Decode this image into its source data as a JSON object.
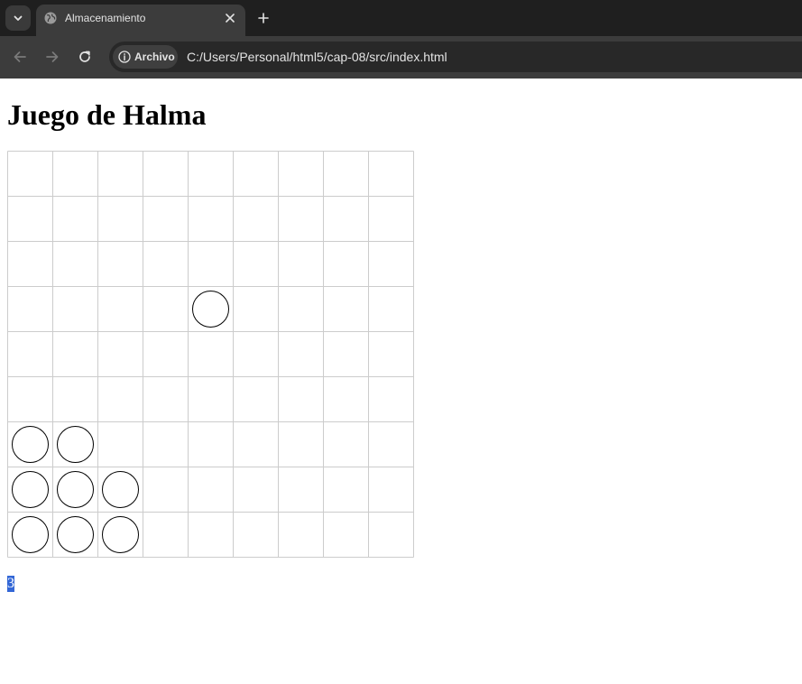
{
  "browser": {
    "tab_title": "Almacenamiento",
    "security_label": "Archivo",
    "url": "C:/Users/Personal/html5/cap-08/src/index.html"
  },
  "page": {
    "title": "Juego de Halma",
    "move_count": "3"
  },
  "board": {
    "columns": 9,
    "rows": 9,
    "grid_color": "#cccccc",
    "piece_stroke": "#000000",
    "pieces": [
      {
        "col": 4,
        "row": 3
      },
      {
        "col": 0,
        "row": 6
      },
      {
        "col": 1,
        "row": 6
      },
      {
        "col": 0,
        "row": 7
      },
      {
        "col": 1,
        "row": 7
      },
      {
        "col": 2,
        "row": 7
      },
      {
        "col": 0,
        "row": 8
      },
      {
        "col": 1,
        "row": 8
      },
      {
        "col": 2,
        "row": 8
      }
    ]
  },
  "icons": {
    "tab_search": "chevron-down-icon",
    "favicon": "globe-icon",
    "close": "close-icon",
    "new_tab": "plus-icon",
    "back": "arrow-left-icon",
    "forward": "arrow-right-icon",
    "reload": "reload-icon",
    "info": "info-icon"
  }
}
